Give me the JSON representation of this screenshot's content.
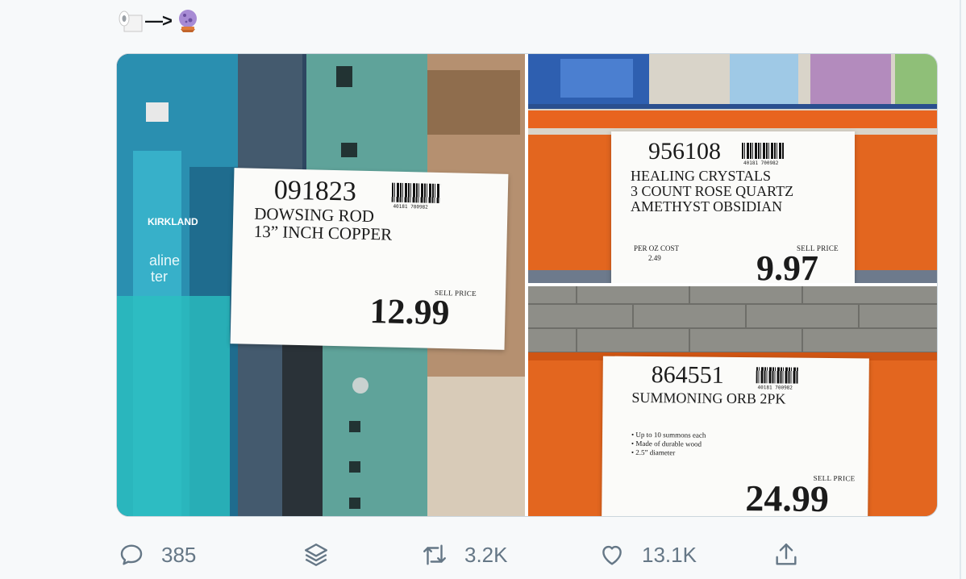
{
  "tweet": {
    "emoji": [
      "toilet-paper-emoji",
      "crystal-ball-emoji"
    ],
    "arrow": "—>"
  },
  "media": {
    "photos": [
      {
        "sku": "091823",
        "description": "DOWSING ROD\n13” INCH COPPER",
        "barcode_number": "40181 700982",
        "sell_price_label": "SELL PRICE",
        "price": "12.99",
        "background_text": [
          "KIRKLAND",
          "aline",
          "ter"
        ]
      },
      {
        "sku": "956108",
        "description": "HEALING CRYSTALS\n3 COUNT ROSE QUARTZ\nAMETHYST OBSIDIAN",
        "barcode_number": "40181 700982",
        "per_oz_label": "PER OZ COST",
        "per_oz_value": "2.49",
        "sell_price_label": "SELL PRICE",
        "price": "9.97"
      },
      {
        "sku": "864551",
        "description": "SUMMONING ORB 2PK",
        "barcode_number": "40181 700982",
        "bullets": "• Up to 10 summons each\n• Made of durable wood\n• 2.5” diameter",
        "sell_price_label": "SELL PRICE",
        "price": "24.99"
      }
    ]
  },
  "actions": {
    "reply": {
      "count": "385",
      "icon": "reply-icon"
    },
    "layers": {
      "icon": "layers-icon"
    },
    "retweet": {
      "count": "3.2K",
      "icon": "retweet-icon"
    },
    "like": {
      "count": "13.1K",
      "icon": "heart-icon"
    },
    "share": {
      "icon": "share-icon"
    }
  },
  "colors": {
    "text": "#14171a",
    "secondary": "#657786",
    "border": "#ccd6dd",
    "background": "#f7f9fa",
    "shelf_orange": "#e8641f",
    "rack_teal": "#5fa39a"
  }
}
